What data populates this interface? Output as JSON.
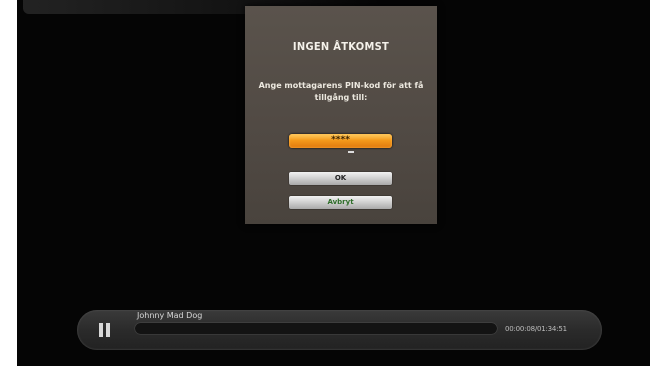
{
  "dialog": {
    "title": "INGEN ÅTKOMST",
    "message": "Ange mottagarens PIN-kod för att få tillgång till:",
    "pin_value": "****",
    "ok_label": "OK",
    "cancel_label": "Avbryt"
  },
  "player": {
    "title": "Johnny Mad Dog",
    "time": "00:00:08/01:34:51",
    "progress": 0.002
  },
  "colors": {
    "pin_highlight": "#f59a1b",
    "cancel_text": "#2f6e2a",
    "dialog_bg": "#514a44"
  }
}
